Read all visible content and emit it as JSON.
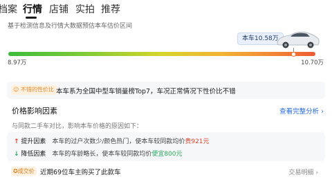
{
  "tabs": [
    {
      "label": "档案"
    },
    {
      "label": "行情",
      "active": true
    },
    {
      "label": "店铺"
    },
    {
      "label": "实拍"
    },
    {
      "label": "推荐"
    }
  ],
  "subtitle": "基于检测信息及行情大数据预估本车估价区间",
  "estimate": {
    "car_label": "本车10.58万",
    "car_price": 10.58,
    "min_label": "8.97万",
    "min_price": 8.97,
    "max_label": "10.70万",
    "max_price": 10.7
  },
  "tag_card": {
    "badge": "不错的性价比",
    "text": "本车系为全国中型车销量榜Top7，车况正常情况下性价比不错"
  },
  "price_factors": {
    "title": "价格影响因素",
    "link": "查看完整分析 ›",
    "description": "与同款二手车对比，影响本车价格的原因如下：",
    "rows": [
      {
        "arrow": "↑",
        "label": "提升因素",
        "text": "本车的过户次数少/颜色热门，使本车较同款均价",
        "price": "贵921元"
      },
      {
        "arrow": "↓",
        "label": "降低因素",
        "text": "本车的车龄略长，使本车较同款均价",
        "price": "便宜800元"
      }
    ]
  },
  "deal": {
    "badge": "成交价",
    "text": "近期69位车主购买了此款车",
    "link": "交易明细 ›"
  },
  "colors": {
    "accent_link": "#2468d8",
    "price_up": "#e0402b",
    "price_down": "#27a85a",
    "badge_orange": "#e08a2e"
  }
}
